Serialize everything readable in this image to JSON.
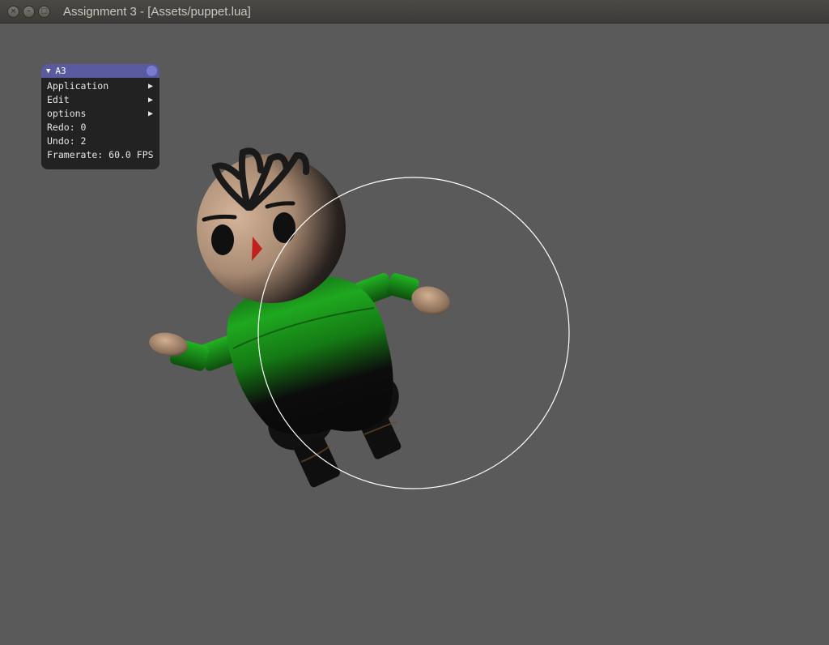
{
  "window": {
    "title": "Assignment 3 - [Assets/puppet.lua]",
    "controls": {
      "close_glyph": "×",
      "minimize_glyph": "–",
      "maximize_glyph": "□"
    }
  },
  "panel": {
    "title": "A3",
    "collapse_glyph": "▼",
    "menus": [
      {
        "label": "Application",
        "arrow": "▶"
      },
      {
        "label": "Edit",
        "arrow": "▶"
      },
      {
        "label": "options",
        "arrow": "▶"
      }
    ],
    "redo": "Redo: 0",
    "undo": "Undo: 2",
    "framerate": "Framerate: 60.0 FPS"
  },
  "colors": {
    "background": "#5a5a5a",
    "panel_header": "#5a5aa0",
    "skin": "#c9a78a",
    "shirt": "#1aa01a",
    "dark": "#111111",
    "nose": "#c0201e",
    "trackball_circle": "#ffffff"
  }
}
